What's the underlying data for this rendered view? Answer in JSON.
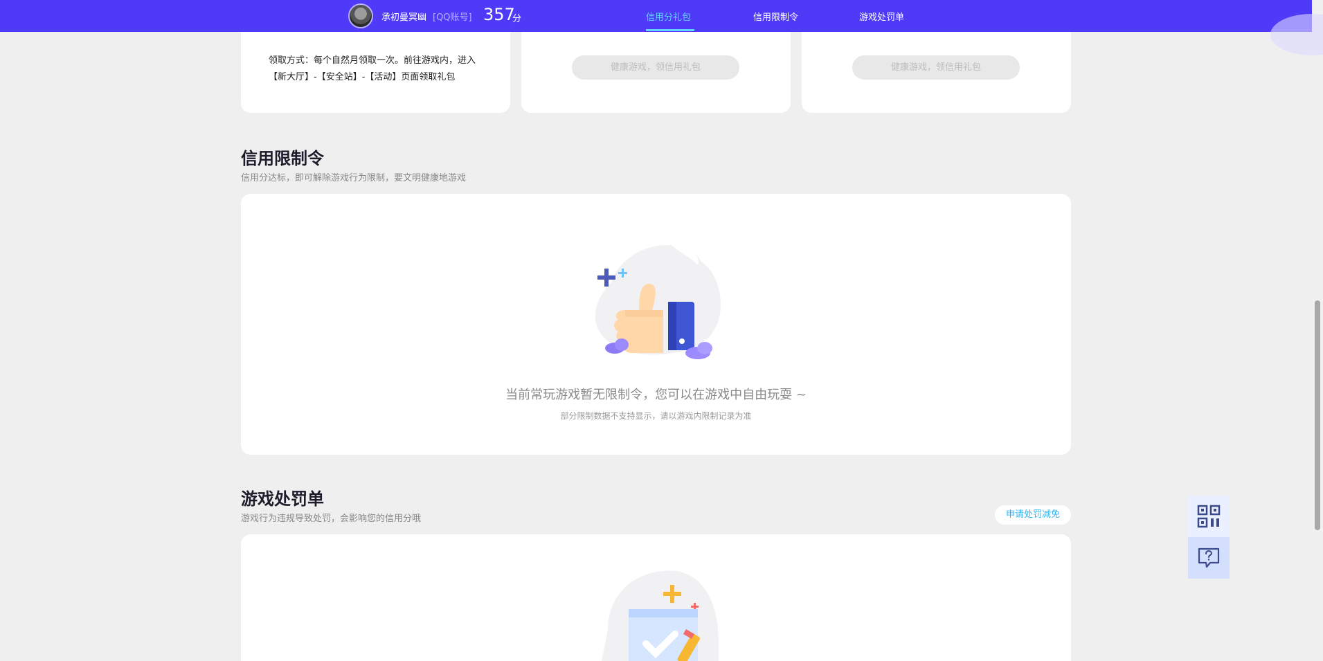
{
  "header": {
    "nickname": "承初曼冥幽",
    "account_type": "[QQ账号]",
    "score": "357",
    "score_unit": "分",
    "nav": [
      {
        "label": "信用分礼包",
        "active": true
      },
      {
        "label": "信用限制令",
        "active": false
      },
      {
        "label": "游戏处罚单",
        "active": false
      }
    ]
  },
  "gift_cards": {
    "claim_text": "领取方式：每个自然月领取一次。前往游戏内，进入【新大厅】-【安全站】-【活动】页面领取礼包",
    "disabled_button_1": "健康游戏，领信用礼包",
    "disabled_button_2": "健康游戏，领信用礼包"
  },
  "restriction": {
    "title": "信用限制令",
    "subtitle": "信用分达标，即可解除游戏行为限制，要文明健康地游戏",
    "empty_main": "当前常玩游戏暂无限制令，您可以在游戏中自由玩耍 ~",
    "empty_sub": "部分限制数据不支持显示，请以游戏内限制记录为准"
  },
  "penalty": {
    "title": "游戏处罚单",
    "subtitle": "游戏行为违规导致处罚，会影响您的信用分哦",
    "appeal_button": "申请处罚减免"
  },
  "colors": {
    "topbar": "#4f3bf7",
    "active_nav": "#5fd2ff",
    "accent_link": "#2fb4f0",
    "page_bg": "#efefef"
  },
  "icons": {
    "float_top": "qr-code-icon",
    "float_bottom": "help-chat-icon"
  }
}
